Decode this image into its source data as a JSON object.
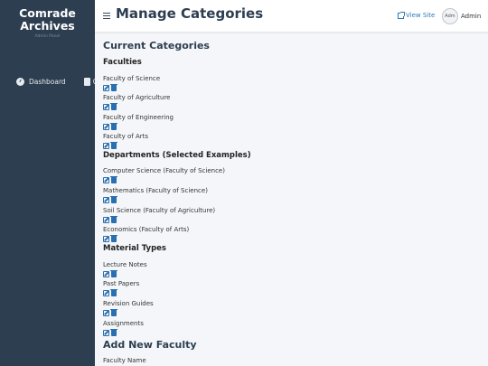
{
  "sidebar": {
    "brand_title_line1": "Comrade",
    "brand_title_line2": "Archives",
    "brand_subtitle": "Admin Panel",
    "nav": [
      {
        "label": "Dashboard",
        "icon": "dashboard-icon"
      },
      {
        "label": "C",
        "icon": "file-icon"
      }
    ]
  },
  "header": {
    "title": "Manage Categories",
    "view_site": "View Site",
    "avatar_alt": "Adm",
    "user_name": "Admin"
  },
  "main": {
    "current_heading": "Current Categories",
    "faculties": {
      "heading": "Faculties",
      "items": [
        "Faculty of Science",
        "Faculty of Agriculture",
        "Faculty of Engineering",
        "Faculty of Arts"
      ]
    },
    "departments": {
      "heading": "Departments (Selected Examples)",
      "items": [
        "Computer Science (Faculty of Science)",
        "Mathematics (Faculty of Science)",
        "Soil Science (Faculty of Agriculture)",
        "Economics (Faculty of Arts)"
      ]
    },
    "material_types": {
      "heading": "Material Types",
      "items": [
        "Lecture Notes",
        "Past Papers",
        "Revision Guides",
        "Assignments"
      ]
    },
    "add_heading": "Add New Faculty",
    "faculty_name_label": "Faculty Name"
  },
  "colors": {
    "sidebar_bg": "#2c3e50",
    "accent": "#2a6fb0",
    "page_bg": "#f4f6f9"
  }
}
